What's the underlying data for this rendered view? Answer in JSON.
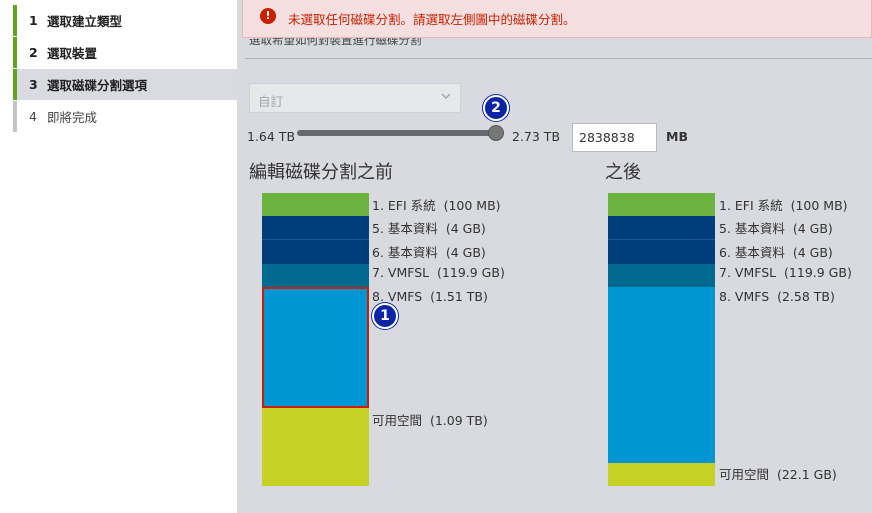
{
  "sidebar": {
    "steps": [
      {
        "num": "1",
        "label": "選取建立類型"
      },
      {
        "num": "2",
        "label": "選取裝置"
      },
      {
        "num": "3",
        "label": "選取磁碟分割選項"
      },
      {
        "num": "4",
        "label": "即將完成"
      }
    ]
  },
  "alert": {
    "icon": "error-icon",
    "message": "未選取任何磁碟分割。請選取左側圖中的磁碟分割。"
  },
  "subtitle": "選取希望如何對裝置進行磁碟分割",
  "layout_select": {
    "value": "自訂"
  },
  "slider": {
    "min_label": "1.64 TB",
    "max_label": "2.73 TB",
    "size_value": "2838838",
    "unit": "MB",
    "level": 1.0
  },
  "badges": {
    "one": "1",
    "two": "2"
  },
  "colors": {
    "efi": "#6db33f",
    "basic": "#003d79",
    "vmfsl": "#006a91",
    "vmfs": "#0095d3",
    "free": "#c5d125",
    "selected_border": "#c92100"
  },
  "before": {
    "title": "編輯磁碟分割之前",
    "partitions": [
      {
        "label": "1. EFI 系統  (100 MB)"
      },
      {
        "label": "5. 基本資料  (4 GB)"
      },
      {
        "label": "6. 基本資料  (4 GB)"
      },
      {
        "label": "7. VMFSL  (119.9 GB)"
      },
      {
        "label": "8. VMFS  (1.51 TB)"
      },
      {
        "label": "可用空間  (1.09 TB)"
      }
    ]
  },
  "after": {
    "title": "之後",
    "partitions": [
      {
        "label": "1. EFI 系統  (100 MB)"
      },
      {
        "label": "5. 基本資料  (4 GB)"
      },
      {
        "label": "6. 基本資料  (4 GB)"
      },
      {
        "label": "7. VMFSL  (119.9 GB)"
      },
      {
        "label": "8. VMFS  (2.58 TB)"
      },
      {
        "label": "可用空間  (22.1 GB)"
      }
    ]
  }
}
